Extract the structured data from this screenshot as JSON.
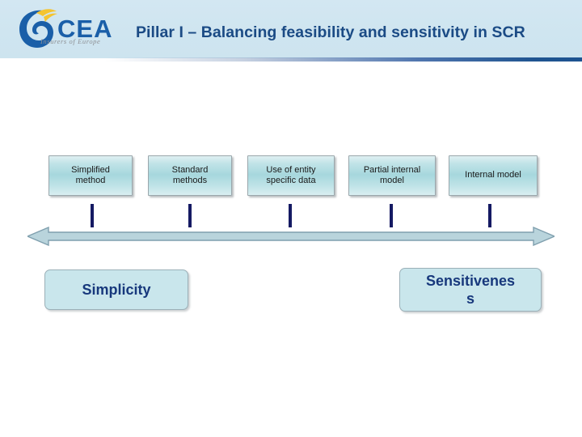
{
  "header": {
    "title": "Pillar I – Balancing feasibility and sensitivity in SCR",
    "logo_text": "CEA",
    "logo_tagline": "Insurers of Europe",
    "band_color": "#cfe5f0",
    "title_color": "#1b4b85",
    "accent_color": "#1f5490"
  },
  "diagram": {
    "methods": [
      {
        "label": "Simplified method",
        "line1": "Simplified",
        "line2": "method"
      },
      {
        "label": "Standard methods",
        "line1": "Standard",
        "line2": "methods"
      },
      {
        "label": "Use of entity specific data",
        "line1": "Use of entity",
        "line2": "specific data"
      },
      {
        "label": "Partial internal model",
        "line1": "Partial internal",
        "line2": "model"
      },
      {
        "label": "Internal model",
        "line1": "Internal model",
        "line2": ""
      }
    ],
    "axis": {
      "type": "double-headed-arrow",
      "left_label": "Simplicity",
      "right_label": "Sensitiveness",
      "right_label_line1": "Sensitivenes",
      "right_label_line2": "s",
      "tick_count": 5,
      "bar_color": "#b9d4dc",
      "bar_outline": "#7fa0ae",
      "tick_color": "#151a63"
    },
    "box_fill": "#a6d7dd",
    "box_border": "#9aa7ac",
    "end_label_fill": "#c9e6ec",
    "end_label_text_color": "#17387c"
  }
}
